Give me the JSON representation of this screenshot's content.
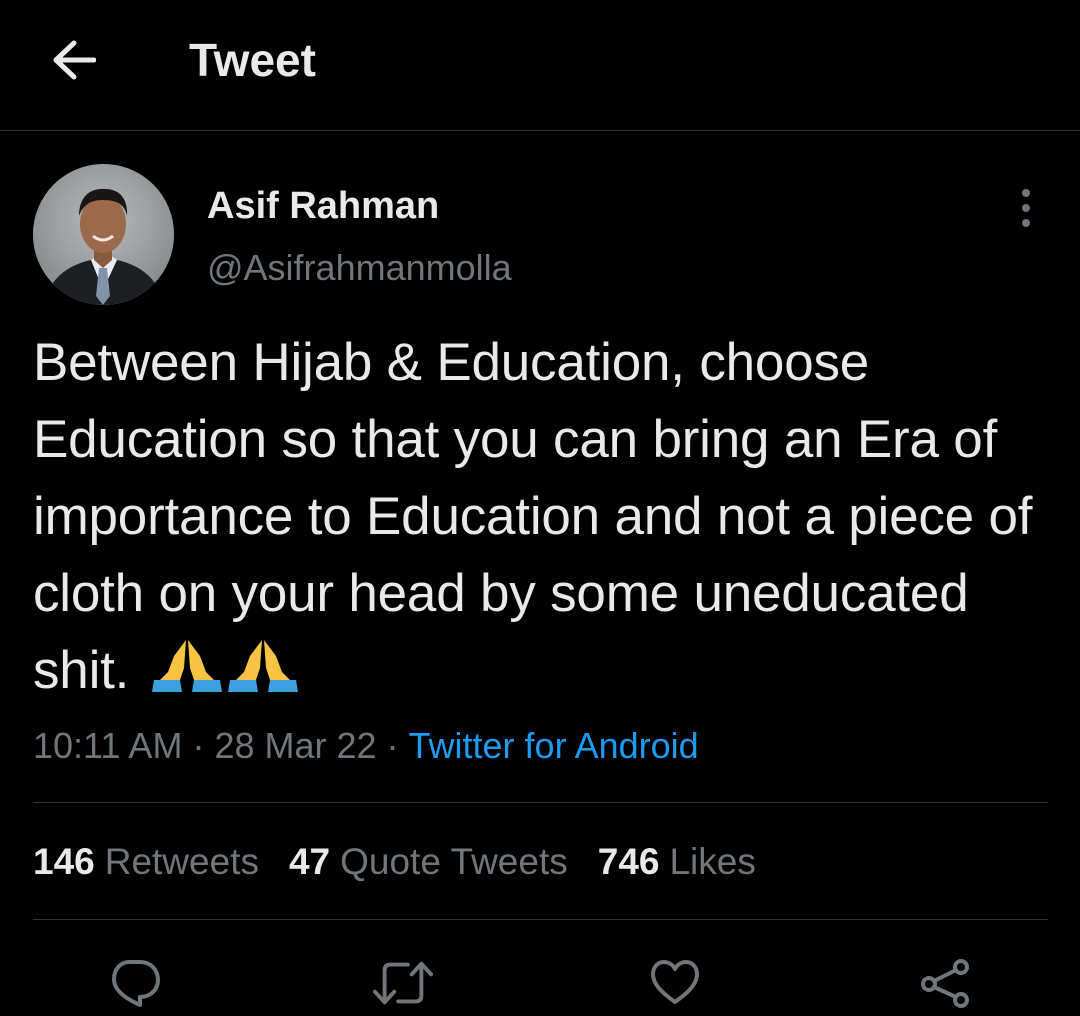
{
  "header": {
    "title": "Tweet",
    "back_icon": "arrow-left-icon"
  },
  "author": {
    "name": "Asif Rahman",
    "handle": "@Asifrahmanmolla",
    "avatar": "profile-photo"
  },
  "tweet": {
    "text": "Between Hijab & Education, choose Education so that you can bring an Era of importance to Education and not a piece of cloth on your head by some uneducated shit.",
    "emoji": "🙏🙏",
    "time": "10:11 AM",
    "separator": "·",
    "date": "28 Mar 22",
    "source": "Twitter for Android"
  },
  "stats": {
    "retweets_count": "146",
    "retweets_label": "Retweets",
    "quotes_count": "47",
    "quotes_label": "Quote Tweets",
    "likes_count": "746",
    "likes_label": "Likes"
  },
  "actions": [
    "reply-icon",
    "retweet-icon",
    "like-icon",
    "share-icon"
  ],
  "colors": {
    "background": "#000000",
    "text": "#e7e9ea",
    "secondary_text": "#71767b",
    "link": "#1d9bf0",
    "divider": "#2f3336"
  }
}
